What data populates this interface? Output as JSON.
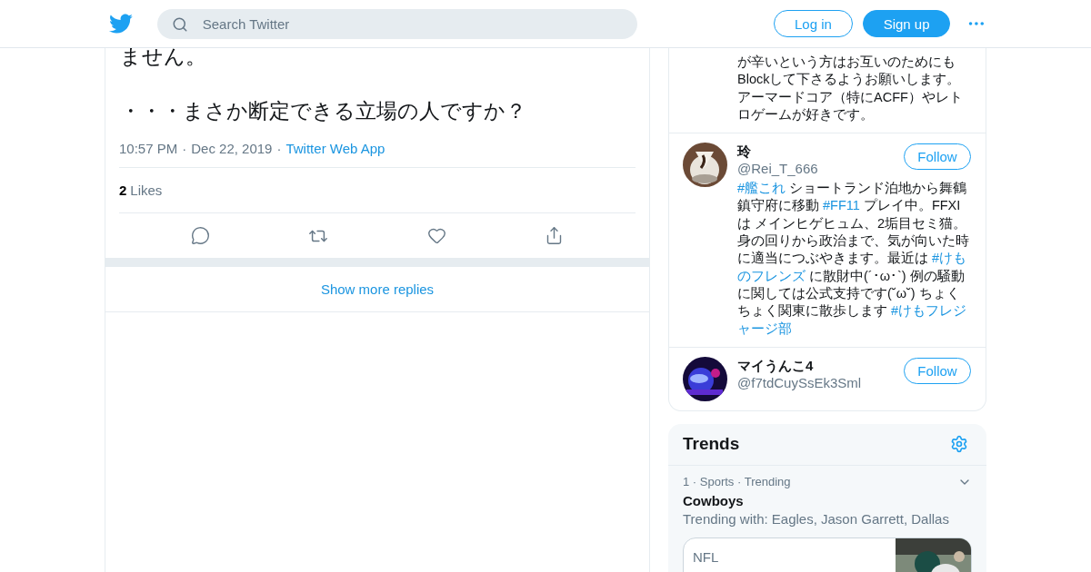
{
  "header": {
    "search_placeholder": "Search Twitter",
    "login": "Log in",
    "signup": "Sign up"
  },
  "tweet": {
    "lines": [
      "ません。",
      "・・・まさか断定できる立場の人ですか？"
    ],
    "meta": [
      {
        "kind": "text",
        "text": "10:57 PM"
      },
      {
        "kind": "sep",
        "text": "·"
      },
      {
        "kind": "text",
        "text": "Dec 22, 2019"
      },
      {
        "kind": "sep",
        "text": "·"
      },
      {
        "kind": "link",
        "text": "Twitter Web App"
      }
    ],
    "likes_count": "2",
    "likes_label": "Likes",
    "show_more": "Show more replies"
  },
  "who_to_follow": [
    {
      "bio": [
        [
          {
            "kind": "text",
            "text": "が辛いという方はお互いのためにも"
          }
        ],
        [
          {
            "kind": "text",
            "text": "Blockして下さるようお願いします。"
          }
        ],
        [
          {
            "kind": "text",
            "text": "アーマードコア（特にACFF）やレト"
          }
        ],
        [
          {
            "kind": "text",
            "text": "ロゲームが好きです。"
          }
        ]
      ]
    },
    {
      "name": "玲",
      "handle": "@Rei_T_666",
      "follow": "Follow",
      "avatar": {
        "kind": "picture"
      },
      "bio": [
        [
          {
            "kind": "hashtag",
            "text": "#艦これ"
          },
          {
            "kind": "text",
            "text": " ショートランド泊地から舞鶴"
          }
        ],
        [
          {
            "kind": "text",
            "text": "鎮守府に移動 "
          },
          {
            "kind": "hashtag",
            "text": "#FF11"
          },
          {
            "kind": "text",
            "text": " プレイ中。FFXI"
          }
        ],
        [
          {
            "kind": "text",
            "text": "は メインヒゲヒュム、2垢目セミ猫。"
          }
        ],
        [
          {
            "kind": "text",
            "text": "身の回りから政治まで、気が向いた時"
          }
        ],
        [
          {
            "kind": "text",
            "text": "に適当につぶやきます。最近は "
          },
          {
            "kind": "hashtag",
            "text": "#けも"
          }
        ],
        [
          {
            "kind": "hashtag",
            "text": "のフレンズ"
          },
          {
            "kind": "text",
            "text": " に散財中(´･ω･`) 例の騒動"
          }
        ],
        [
          {
            "kind": "text",
            "text": "に関しては公式支持です(˘ω˘) ちょく"
          }
        ],
        [
          {
            "kind": "text",
            "text": "ちょく関東に散歩します "
          },
          {
            "kind": "hashtag",
            "text": "#けもフレジ"
          }
        ],
        [
          {
            "kind": "hashtag",
            "text": "ャージ部"
          }
        ]
      ]
    },
    {
      "name": "マイうんこ4",
      "handle": "@f7tdCuySsEk3Sml",
      "follow": "Follow",
      "avatar": {
        "kind": "picture"
      }
    }
  ],
  "trends": {
    "title": "Trends",
    "items": [
      {
        "meta": "1 · Sports · Trending",
        "name": "Cowboys",
        "context": "Trending with: Eagles, Jason Garrett, Dallas",
        "card_label": "NFL"
      }
    ]
  }
}
